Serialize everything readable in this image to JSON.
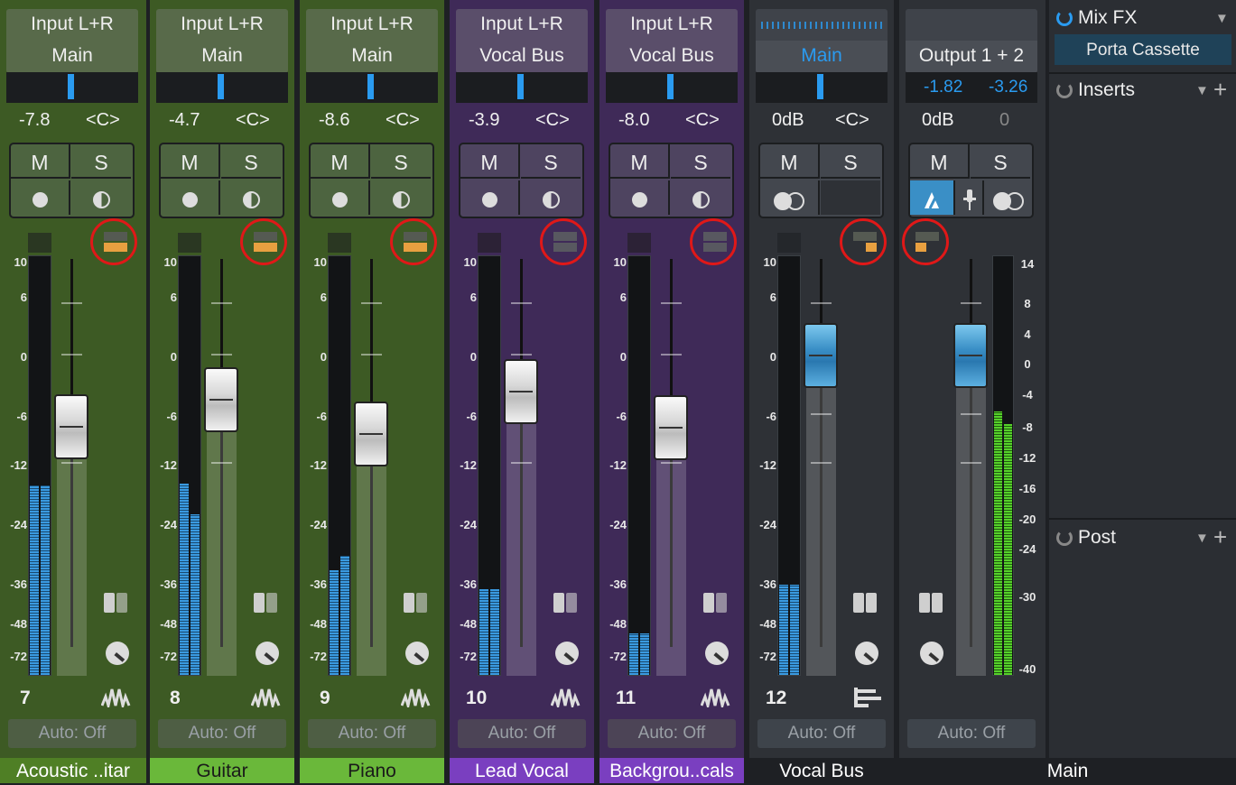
{
  "colors": {
    "green": "#3d5a24",
    "purple": "#3f2a58",
    "gray": "#2e3136",
    "accent_blue": "#2a9bf0"
  },
  "strips": [
    {
      "input": "Input L+R",
      "output": "Main",
      "volume": "-7.8",
      "pan": "<C>",
      "mute": "M",
      "solo": "S",
      "number": "7",
      "auto": "Auto: Off",
      "name": "Acoustic ..itar",
      "name_bg": "#4f7f25"
    },
    {
      "input": "Input L+R",
      "output": "Main",
      "volume": "-4.7",
      "pan": "<C>",
      "mute": "M",
      "solo": "S",
      "number": "8",
      "auto": "Auto: Off",
      "name": "Guitar",
      "name_bg": "#6ab83a"
    },
    {
      "input": "Input L+R",
      "output": "Main",
      "volume": "-8.6",
      "pan": "<C>",
      "mute": "M",
      "solo": "S",
      "number": "9",
      "auto": "Auto: Off",
      "name": "Piano",
      "name_bg": "#6ab83a"
    },
    {
      "input": "Input L+R",
      "output": "Vocal Bus",
      "volume": "-3.9",
      "pan": "<C>",
      "mute": "M",
      "solo": "S",
      "number": "10",
      "auto": "Auto: Off",
      "name": "Lead Vocal",
      "name_bg": "#7a3fc0"
    },
    {
      "input": "Input L+R",
      "output": "Vocal Bus",
      "volume": "-8.0",
      "pan": "<C>",
      "mute": "M",
      "solo": "S",
      "number": "11",
      "auto": "Auto: Off",
      "name": "Backgrou..cals",
      "name_bg": "#7a3fc0"
    },
    {
      "input": "",
      "output": "Main",
      "volume": "0dB",
      "pan": "<C>",
      "mute": "M",
      "solo": "S",
      "number": "12",
      "auto": "Auto: Off",
      "name": "Vocal Bus",
      "name_bg": "#1e2024"
    }
  ],
  "main": {
    "output": "Output 1 + 2",
    "peak_l": "-1.82",
    "peak_r": "-3.26",
    "volume": "0dB",
    "pan": "0",
    "mute": "M",
    "solo": "S",
    "auto": "Auto: Off",
    "name": "Main"
  },
  "scale": [
    "10",
    "6",
    "0",
    "-6",
    "-12",
    "-24",
    "-36",
    "-48",
    "-72"
  ],
  "main_scale": [
    "14",
    "8",
    "4",
    "0",
    "-4",
    "-8",
    "-12",
    "-16",
    "-20",
    "-24",
    "-30",
    "-40"
  ],
  "panel": {
    "mixfx": "Mix FX",
    "fx_slot": "Porta Cassette",
    "inserts": "Inserts",
    "post": "Post"
  }
}
